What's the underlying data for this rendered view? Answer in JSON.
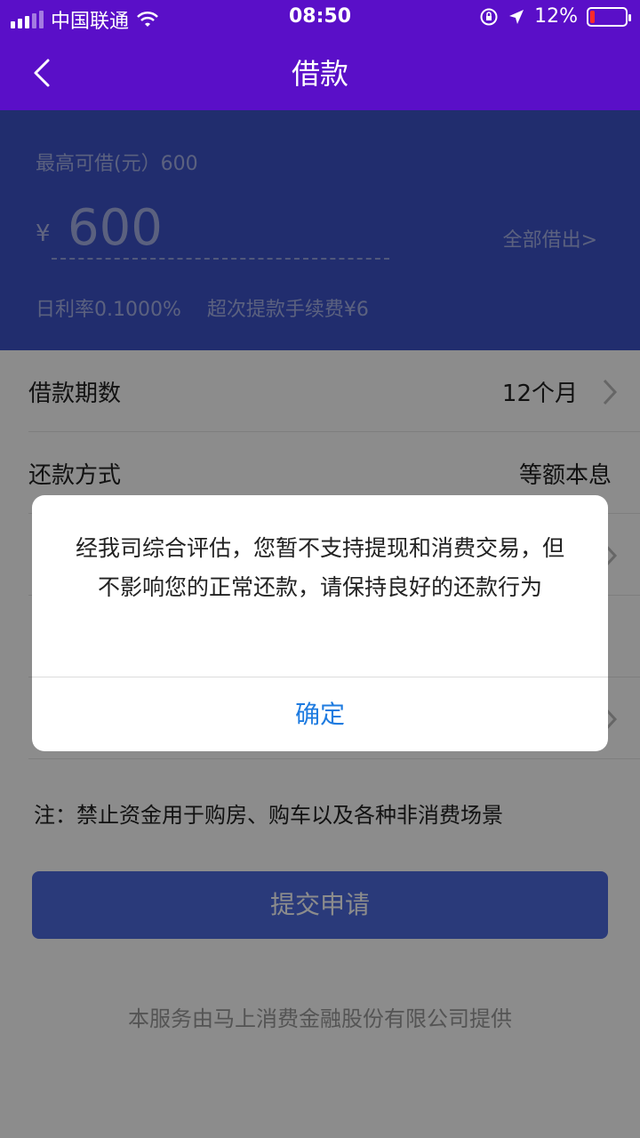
{
  "status_bar": {
    "carrier": "中国联通",
    "time": "08:50",
    "battery": "12%",
    "battery_level": 0.12
  },
  "nav": {
    "title": "借款"
  },
  "summary": {
    "max_label": "最高可借(元）600",
    "currency": "¥",
    "amount": "600",
    "borrow_all": "全部借出>",
    "rate": "日利率0.1000%",
    "fee": "超次提款手续费¥6"
  },
  "rows": [
    {
      "label": "借款期数",
      "value": "12个月"
    },
    {
      "label": "还款方式",
      "value": "等额本息"
    },
    {
      "label": "",
      "value": ""
    },
    {
      "label": "",
      "value": ""
    },
    {
      "label": "",
      "value": ""
    }
  ],
  "note": "注：禁止资金用于购房、购车以及各种非消费场景",
  "submit_label": "提交申请",
  "footer": "本服务由马上消费金融股份有限公司提供",
  "dialog": {
    "message": "经我司综合评估，您暂不支持提现和消费交易，但不影响您的正常还款，请保持良好的还款行为",
    "confirm": "确定"
  },
  "colors": {
    "header": "#5a0fc8",
    "summary_bg": "#3c52c9",
    "accent": "#1e7be0"
  }
}
